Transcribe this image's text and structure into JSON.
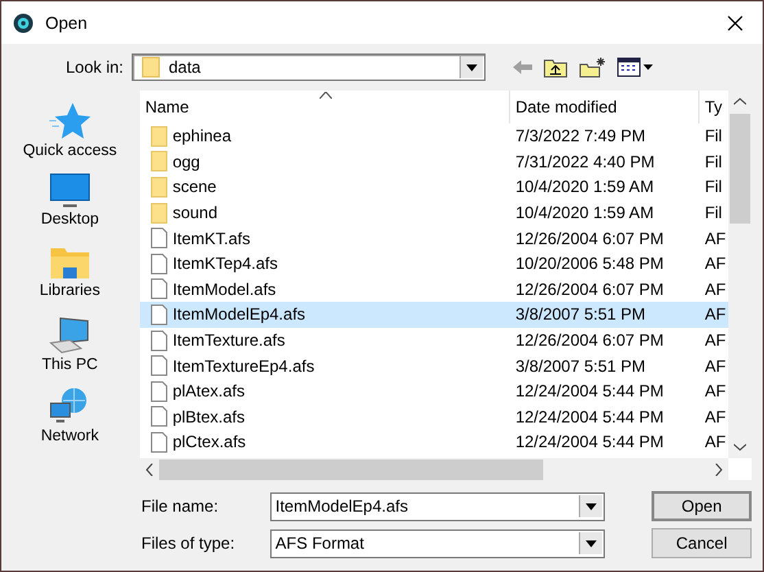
{
  "window": {
    "title": "Open"
  },
  "look_in": {
    "label": "Look in:",
    "value": "data"
  },
  "places": [
    {
      "label": "Quick access",
      "kind": "star"
    },
    {
      "label": "Desktop",
      "kind": "desktop"
    },
    {
      "label": "Libraries",
      "kind": "libraries"
    },
    {
      "label": "This PC",
      "kind": "pc"
    },
    {
      "label": "Network",
      "kind": "network"
    }
  ],
  "columns": [
    "Name",
    "Date modified",
    "Ty"
  ],
  "rows": [
    {
      "name": "ephinea",
      "date": "7/3/2022 7:49 PM",
      "type": "Fil",
      "kind": "folder",
      "selected": false
    },
    {
      "name": "ogg",
      "date": "7/31/2022 4:40 PM",
      "type": "Fil",
      "kind": "folder",
      "selected": false
    },
    {
      "name": "scene",
      "date": "10/4/2020 1:59 AM",
      "type": "Fil",
      "kind": "folder",
      "selected": false
    },
    {
      "name": "sound",
      "date": "10/4/2020 1:59 AM",
      "type": "Fil",
      "kind": "folder",
      "selected": false
    },
    {
      "name": "ItemKT.afs",
      "date": "12/26/2004 6:07 PM",
      "type": "AF",
      "kind": "file",
      "selected": false
    },
    {
      "name": "ItemKTep4.afs",
      "date": "10/20/2006 5:48 PM",
      "type": "AF",
      "kind": "file",
      "selected": false
    },
    {
      "name": "ItemModel.afs",
      "date": "12/26/2004 6:07 PM",
      "type": "AF",
      "kind": "file",
      "selected": false
    },
    {
      "name": "ItemModelEp4.afs",
      "date": "3/8/2007 5:51 PM",
      "type": "AF",
      "kind": "file",
      "selected": true
    },
    {
      "name": "ItemTexture.afs",
      "date": "12/26/2004 6:07 PM",
      "type": "AF",
      "kind": "file",
      "selected": false
    },
    {
      "name": "ItemTextureEp4.afs",
      "date": "3/8/2007 5:51 PM",
      "type": "AF",
      "kind": "file",
      "selected": false
    },
    {
      "name": "plAtex.afs",
      "date": "12/24/2004 5:44 PM",
      "type": "AF",
      "kind": "file",
      "selected": false
    },
    {
      "name": "plBtex.afs",
      "date": "12/24/2004 5:44 PM",
      "type": "AF",
      "kind": "file",
      "selected": false
    },
    {
      "name": "plCtex.afs",
      "date": "12/24/2004 5:44 PM",
      "type": "AF",
      "kind": "file",
      "selected": false
    }
  ],
  "file_name": {
    "label": "File name:",
    "value": "ItemModelEp4.afs"
  },
  "file_type": {
    "label": "Files of type:",
    "value": "AFS Format"
  },
  "buttons": [
    "Open",
    "Cancel"
  ]
}
